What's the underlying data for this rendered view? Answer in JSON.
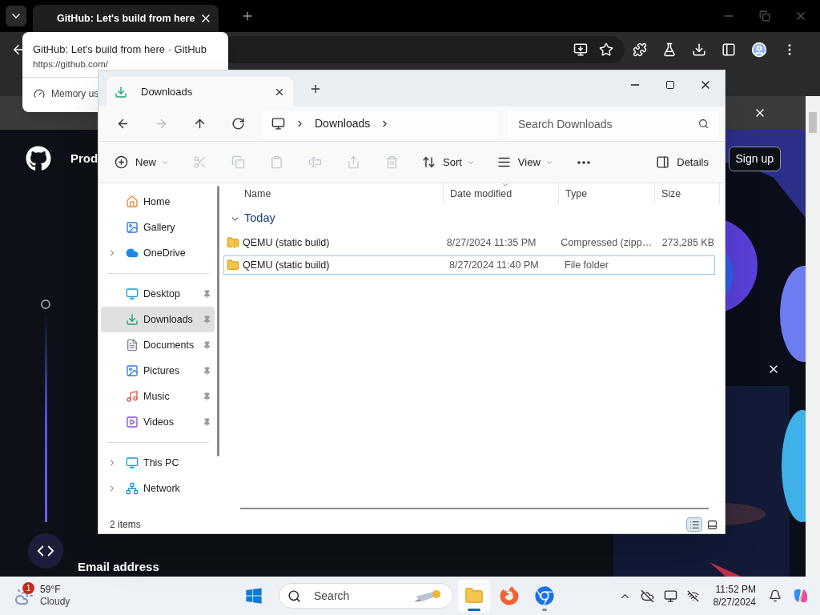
{
  "browser": {
    "tab": {
      "title": "GitHub: Let's build from here"
    },
    "tooltip": {
      "title": "GitHub: Let's build from here · GitHub",
      "url": "https://github.com/",
      "memory": "Memory us"
    },
    "page": {
      "nav_item": "Prod",
      "sign_up": "Sign up",
      "email_label": "Email address"
    }
  },
  "explorer": {
    "tab": {
      "title": "Downloads"
    },
    "nav": [
      {
        "kind": "back",
        "disabled": false
      },
      {
        "kind": "forward",
        "disabled": true
      },
      {
        "kind": "up",
        "disabled": false
      },
      {
        "kind": "refresh",
        "disabled": false
      }
    ],
    "breadcrumb": [
      "Downloads"
    ],
    "search": {
      "placeholder": "Search Downloads"
    },
    "commands": [
      {
        "kind": "new",
        "label": "New",
        "disabled": false
      },
      {
        "kind": "cut",
        "disabled": true
      },
      {
        "kind": "copy",
        "disabled": true
      },
      {
        "kind": "paste",
        "disabled": true
      },
      {
        "kind": "rename",
        "disabled": true
      },
      {
        "kind": "share",
        "disabled": true
      },
      {
        "kind": "delete",
        "disabled": true
      },
      {
        "kind": "sort",
        "label": "Sort",
        "disabled": false
      },
      {
        "kind": "view",
        "label": "View",
        "disabled": false
      },
      {
        "kind": "more",
        "disabled": false
      }
    ],
    "details_label": "Details",
    "sidebar": [
      {
        "items": [
          {
            "label": "Home",
            "kind": "plain",
            "pinned": false,
            "selected": false
          },
          {
            "label": "Gallery",
            "kind": "plain",
            "pinned": false,
            "selected": false
          },
          {
            "label": "OneDrive",
            "kind": "expandable",
            "pinned": false,
            "selected": false
          }
        ]
      },
      {
        "items": [
          {
            "label": "Desktop",
            "kind": "plain",
            "pinned": true,
            "selected": false
          },
          {
            "label": "Downloads",
            "kind": "plain",
            "pinned": true,
            "selected": true
          },
          {
            "label": "Documents",
            "kind": "plain",
            "pinned": true,
            "selected": false
          },
          {
            "label": "Pictures",
            "kind": "plain",
            "pinned": true,
            "selected": false
          },
          {
            "label": "Music",
            "kind": "plain",
            "pinned": true,
            "selected": false
          },
          {
            "label": "Videos",
            "kind": "plain",
            "pinned": true,
            "selected": false
          }
        ]
      },
      {
        "items": [
          {
            "label": "This PC",
            "kind": "expandable",
            "pinned": false,
            "selected": false
          },
          {
            "label": "Network",
            "kind": "expandable",
            "pinned": false,
            "selected": false
          }
        ]
      }
    ],
    "columns": [
      {
        "label": "Name",
        "sorted": false
      },
      {
        "label": "Date modified",
        "sorted": true
      },
      {
        "label": "Type",
        "sorted": false
      },
      {
        "label": "Size",
        "sorted": false
      }
    ],
    "groups": [
      {
        "label": "Today",
        "expanded": true,
        "rows": [
          {
            "kind": "archive",
            "name": "QEMU (static build)",
            "date": "8/27/2024 11:35 PM",
            "type": "Compressed (zipp…",
            "size": "273,285 KB",
            "focused": false
          },
          {
            "kind": "folder",
            "name": "QEMU (static build)",
            "date": "8/27/2024 11:40 PM",
            "type": "File folder",
            "focused": true
          }
        ]
      }
    ],
    "status": "2 items",
    "views": [
      {
        "kind": "details",
        "selected": true
      },
      {
        "kind": "preview",
        "selected": false
      }
    ]
  },
  "taskbar": {
    "weather": {
      "badge": "1",
      "temperature": "59°F",
      "condition": "Cloudy"
    },
    "search_label": "Search",
    "apps": [
      {
        "kind": "explorer",
        "running": true,
        "active": true
      },
      {
        "kind": "firefox",
        "running": false,
        "active": false
      },
      {
        "kind": "chrome",
        "running": true,
        "active": false
      }
    ],
    "time": "11:52 PM",
    "date": "8/27/2024"
  }
}
